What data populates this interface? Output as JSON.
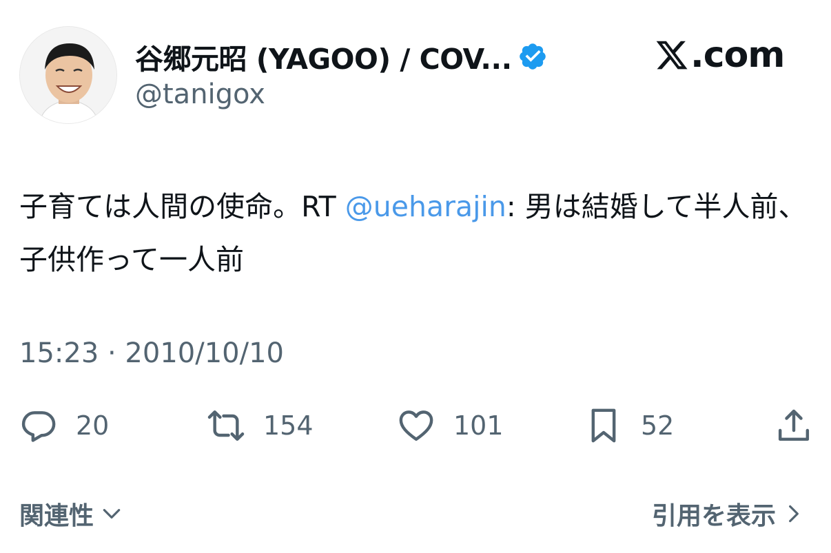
{
  "header": {
    "display_name": "谷郷元昭 (YAGOO) / COV...",
    "handle": "@tanigox",
    "brand": ".com"
  },
  "tweet": {
    "text_before": "子育ては人間の使命。RT ",
    "mention": "@ueharajin",
    "text_after": ": 男は結婚して半人前、子供作って一人前",
    "timestamp": "15:23 · 2010/10/10"
  },
  "actions": {
    "reply_count": "20",
    "retweet_count": "154",
    "like_count": "101",
    "bookmark_count": "52"
  },
  "footer": {
    "relevance_label": "関連性",
    "quotes_label": "引用を表示"
  },
  "colors": {
    "verified": "#1d9bf0",
    "mention": "#4a99e9",
    "secondary_text": "#536471"
  }
}
